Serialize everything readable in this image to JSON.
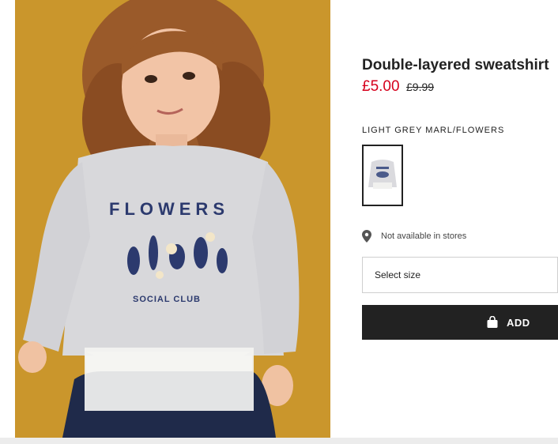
{
  "product": {
    "title": "Double-layered sweatshirt",
    "price_current": "£5.00",
    "price_original": "£9.99",
    "colour_name": "LIGHT GREY MARL/FLOWERS",
    "swatch_alt": "Light grey marl/flowers swatch",
    "photo_alt": "Child wearing a light grey sweatshirt with FLOWERS SOCIAL CLUB print",
    "print_text_top": "FLOWERS",
    "print_text_bottom": "SOCIAL CLUB"
  },
  "availability": {
    "icon": "location-pin-icon",
    "text": "Not available in stores"
  },
  "size_select": {
    "placeholder": "Select size"
  },
  "add_button": {
    "icon": "shopping-bag-icon",
    "label": "ADD"
  },
  "colors": {
    "sale_price": "#d6001c",
    "button_bg": "#222222",
    "photo_bg": "#cf9a2e"
  }
}
